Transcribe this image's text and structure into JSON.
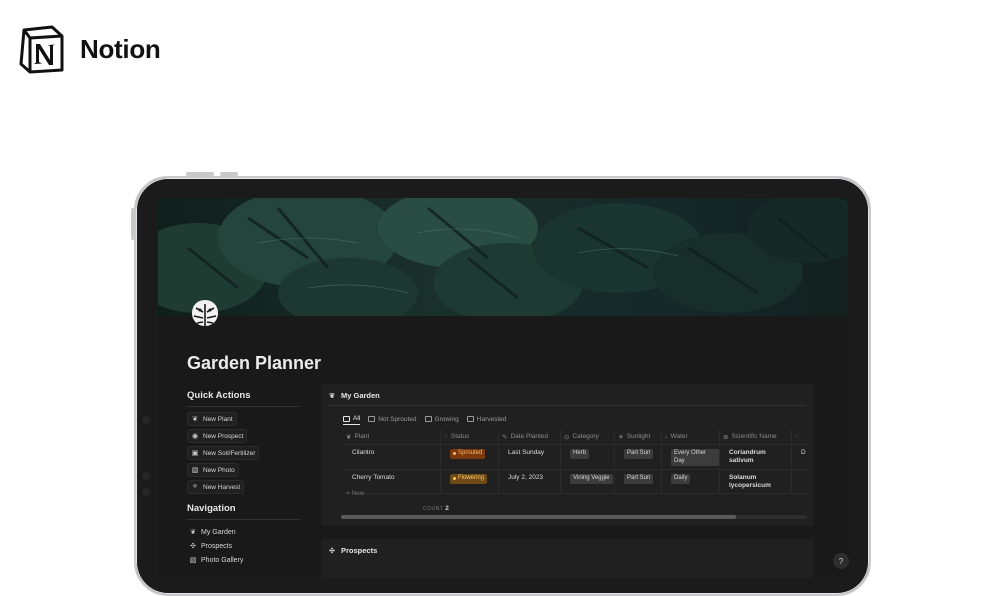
{
  "brand": {
    "name": "Notion",
    "logo_icon": "notion-logo-icon"
  },
  "page": {
    "title": "Garden Planner",
    "icon": "monstera-leaf-icon"
  },
  "quick_actions": {
    "title": "Quick Actions",
    "buttons": [
      {
        "label": "New Plant",
        "icon": "seedling-icon"
      },
      {
        "label": "New Prospect",
        "icon": "compass-icon"
      },
      {
        "label": "New Soil/Fertilizer",
        "icon": "bag-icon"
      },
      {
        "label": "New Photo",
        "icon": "photo-icon"
      },
      {
        "label": "New Harvest",
        "icon": "carrot-icon"
      }
    ]
  },
  "navigation": {
    "title": "Navigation",
    "items": [
      {
        "label": "My Garden",
        "icon": "seedling-icon"
      },
      {
        "label": "Prospects",
        "icon": "cactus-icon"
      },
      {
        "label": "Photo Gallery",
        "icon": "photo-icon"
      }
    ]
  },
  "my_garden": {
    "title": "My Garden",
    "tabs": [
      {
        "label": "All",
        "active": true
      },
      {
        "label": "Not Sprouted",
        "active": false
      },
      {
        "label": "Growing",
        "active": false
      },
      {
        "label": "Harvested",
        "active": false
      }
    ],
    "columns": [
      "Plant",
      "Status",
      "Date Planted",
      "Category",
      "Sunlight",
      "Water",
      "Scientific Name"
    ],
    "rows": [
      {
        "plant": "Cilantro",
        "status": "Sprouted",
        "date": "Last Sunday",
        "category": "Herb",
        "sunlight": "Part Sun",
        "water": "Every Other Day",
        "scientific": "Coriandrum sativum",
        "extra": "D"
      },
      {
        "plant": "Cherry Tomato",
        "status": "Flowering",
        "date": "July 2, 2023",
        "category": "Vining Veggie",
        "sunlight": "Part Sun",
        "water": "Daily",
        "scientific": "Solanum lycopersicum",
        "extra": ""
      }
    ],
    "new_label": "+ New",
    "count_label": "COUNT",
    "count_value": "2"
  },
  "prospects": {
    "title": "Prospects"
  },
  "help_label": "?",
  "colors": {
    "screen_bg": "#191919",
    "panel_bg": "#202020",
    "sprouted": "#7a3a0e",
    "flowering": "#6e4a17"
  }
}
